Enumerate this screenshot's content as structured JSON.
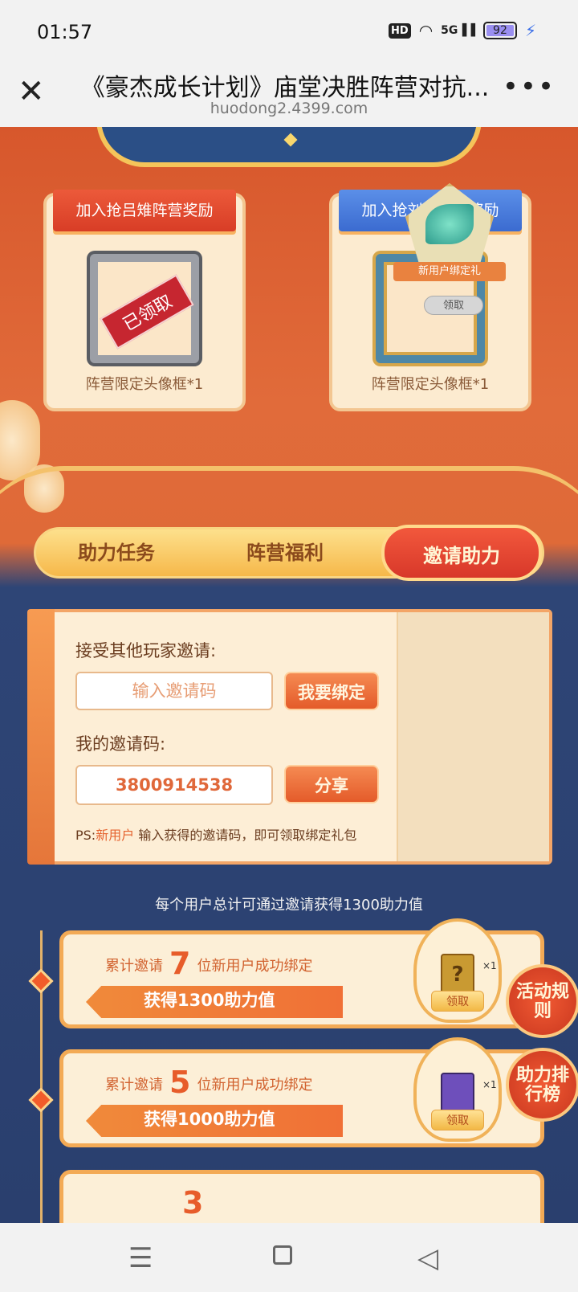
{
  "status": {
    "time": "01:57",
    "hd": "HD",
    "network": "5G",
    "battery": "92"
  },
  "browser": {
    "title": "《豪杰成长计划》庙堂决胜阵营对抗...",
    "url": "huodong2.4399.com"
  },
  "rewards": [
    {
      "banner": "加入抢吕雉阵营奖励",
      "caption": "阵营限定头像框*1",
      "stamp": "已领取"
    },
    {
      "banner": "加入抢刘邦阵营奖励",
      "caption": "阵营限定头像框*1"
    }
  ],
  "tabs": [
    "助力任务",
    "阵营福利",
    "邀请助力"
  ],
  "invite": {
    "accept_label": "接受其他玩家邀请:",
    "input_placeholder": "输入邀请码",
    "bind_button": "我要绑定",
    "my_code_label": "我的邀请码:",
    "my_code": "3800914538",
    "share_button": "分享",
    "ps_prefix": "PS:",
    "ps_highlight": "新用户",
    "ps_suffix": "输入获得的邀请码，即可领取绑定礼包",
    "gift_label": "新用户绑定礼",
    "gift_claim": "领取"
  },
  "total_note": "每个用户总计可通过邀请获得1300助力值",
  "tasks": [
    {
      "prefix": "累计邀请",
      "count": "7",
      "suffix": "位新用户成功绑定",
      "reward": "获得1300助力值",
      "qty": "×1",
      "claim": "领取",
      "item_icon": "mystery-card-icon"
    },
    {
      "prefix": "累计邀请",
      "count": "5",
      "suffix": "位新用户成功绑定",
      "reward": "获得1000助力值",
      "qty": "×1",
      "claim": "领取",
      "item_icon": "purple-tablet-icon"
    },
    {
      "count": "3"
    }
  ],
  "float_buttons": {
    "rules": "活动规则",
    "ranking": "助力排行榜"
  },
  "colors": {
    "accent_orange": "#e45b2a",
    "panel_cream": "#fdeed6",
    "deep_blue": "#2a3f6e"
  }
}
